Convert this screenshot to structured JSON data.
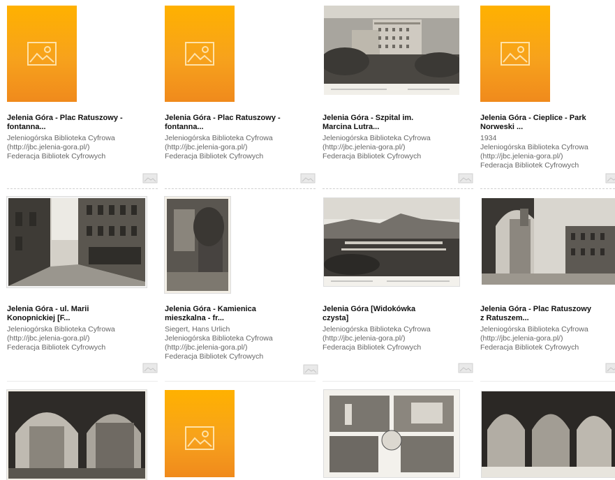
{
  "results": [
    {
      "title_line1": "Jelenia Góra - Plac Ratuszowy -",
      "title_line2": "fontanna...",
      "meta": [
        "Jeleniogórska Biblioteka Cyfrowa",
        "(http://jbc.jelenia-gora.pl/)",
        "Federacja Bibliotek Cyfrowych"
      ],
      "thumb": "placeholder-image-icon"
    },
    {
      "title_line1": "Jelenia Góra - Plac Ratuszowy -",
      "title_line2": "fontanna...",
      "meta": [
        "Jeleniogórska Biblioteka Cyfrowa",
        "(http://jbc.jelenia-gora.pl/)",
        "Federacja Bibliotek Cyfrowych"
      ],
      "thumb": "placeholder-image-icon"
    },
    {
      "title_line1": "Jelenia Góra - Szpital im.",
      "title_line2": "Marcina Lutra...",
      "meta": [
        "Jeleniogórska Biblioteka Cyfrowa",
        "(http://jbc.jelenia-gora.pl/)",
        "Federacja Bibliotek Cyfrowych"
      ],
      "thumb": "photo"
    },
    {
      "title_line1": "Jelenia Góra - Cieplice - Park",
      "title_line2": "Norweski ...",
      "meta": [
        "1934",
        "Jeleniogórska Biblioteka Cyfrowa",
        "(http://jbc.jelenia-gora.pl/)",
        "Federacja Bibliotek Cyfrowych"
      ],
      "thumb": "placeholder-image-icon"
    },
    {
      "title_line1": "Jelenia Góra - ul. Marii",
      "title_line2": "Konopnickiej [F...",
      "meta": [
        "Jeleniogórska Biblioteka Cyfrowa",
        "(http://jbc.jelenia-gora.pl/)",
        "Federacja Bibliotek Cyfrowych"
      ],
      "thumb": "photo"
    },
    {
      "title_line1": "Jelenia Góra - Kamienica",
      "title_line2": "mieszkalna - fr...",
      "meta": [
        "Siegert, Hans Urlich",
        "Jeleniogórska Biblioteka Cyfrowa",
        "(http://jbc.jelenia-gora.pl/)",
        "Federacja Bibliotek Cyfrowych"
      ],
      "thumb": "photo"
    },
    {
      "title_line1": "Jelenia Góra [Widokówka",
      "title_line2": "czysta]",
      "meta": [
        "Jeleniogórska Biblioteka Cyfrowa",
        "(http://jbc.jelenia-gora.pl/)",
        "Federacja Bibliotek Cyfrowych"
      ],
      "thumb": "photo"
    },
    {
      "title_line1": "Jelenia Góra - Plac Ratuszowy",
      "title_line2": "z Ratuszem...",
      "meta": [
        "Jeleniogórska Biblioteka Cyfrowa",
        "(http://jbc.jelenia-gora.pl/)",
        "Federacja Bibliotek Cyfrowych"
      ],
      "thumb": "photo"
    }
  ],
  "colors": {
    "placeholder": "#f7a21c",
    "title": "#111111",
    "meta": "#666666"
  }
}
